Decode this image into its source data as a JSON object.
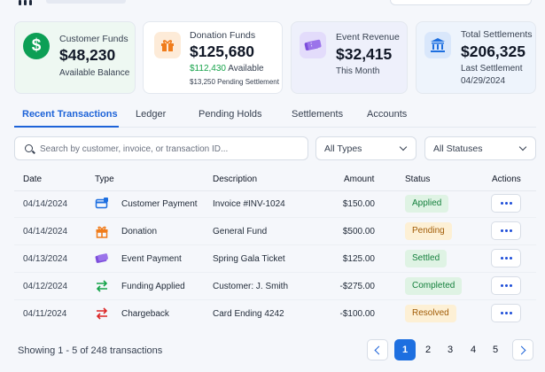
{
  "cards": [
    {
      "label": "Customer Funds",
      "value": "$48,230",
      "sub": "Available Balance",
      "icon": "dollar-icon",
      "accent": "#0c9f55"
    },
    {
      "label": "Donation Funds",
      "value": "$125,680",
      "sub_amount": "$112,430",
      "sub_text": "Available",
      "sub2": "$13,250 Pending Settlement",
      "icon": "gift-icon",
      "accent": "#f07c1b"
    },
    {
      "label": "Event Revenue",
      "value": "$32,415",
      "sub": "This Month",
      "icon": "ticket-icon",
      "accent": "#7c4ddb"
    },
    {
      "label": "Total Settlements",
      "value": "$206,325",
      "sub": "Last Settlement",
      "sub2": "04/29/2024",
      "icon": "bank-icon",
      "accent": "#1d6fe0"
    }
  ],
  "tabs": [
    "Recent Transactions",
    "Ledger",
    "Pending Holds",
    "Settlements",
    "Accounts"
  ],
  "active_tab": "Recent Transactions",
  "search": {
    "placeholder": "Search by customer, invoice, or transaction ID..."
  },
  "filters": {
    "type": "All Types",
    "status": "All Statuses"
  },
  "table": {
    "headers": [
      "Date",
      "Type",
      "Description",
      "Amount",
      "Status",
      "Actions"
    ],
    "rows": [
      {
        "date": "04/14/2024",
        "type": "Customer Payment",
        "description": "Invoice #INV-1024",
        "amount": "$150.00",
        "status": "Applied",
        "icon": "invoice-icon"
      },
      {
        "date": "04/14/2024",
        "type": "Donation",
        "description": "General Fund",
        "amount": "$500.00",
        "status": "Pending",
        "icon": "gift-icon"
      },
      {
        "date": "04/13/2024",
        "type": "Event Payment",
        "description": "Spring Gala Ticket",
        "amount": "$125.00",
        "status": "Settled",
        "icon": "ticket-icon"
      },
      {
        "date": "04/12/2024",
        "type": "Funding Applied",
        "description": "Customer: J. Smith",
        "amount": "-$275.00",
        "status": "Completed",
        "icon": "transfer-icon"
      },
      {
        "date": "04/11/2024",
        "type": "Chargeback",
        "description": "Card Ending 4242",
        "amount": "-$100.00",
        "status": "Resolved",
        "icon": "chargeback-icon"
      }
    ]
  },
  "footer": {
    "showing": "Showing 1 - 5 of 248 transactions",
    "pages": [
      "1",
      "2",
      "3",
      "4",
      "5"
    ],
    "current_page": "1"
  }
}
